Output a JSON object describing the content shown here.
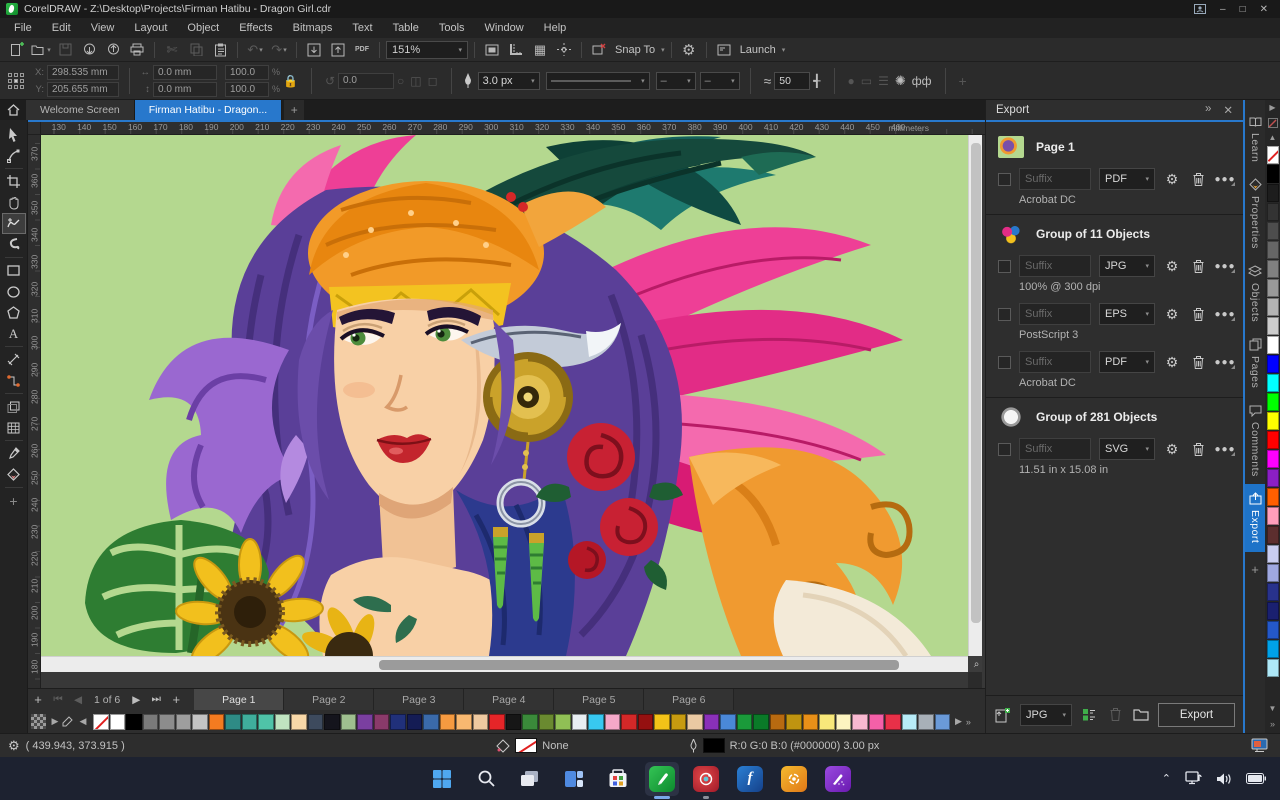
{
  "accent": {
    "active_blue": "#2878cc",
    "corel_green": "#1fa83a",
    "page_green": "#b4d88f"
  },
  "titlebar": {
    "title": "CorelDRAW - Z:\\Desktop\\Projects\\Firman Hatibu - Dragon Girl.cdr"
  },
  "menubar": {
    "items": [
      {
        "label": "File"
      },
      {
        "label": "Edit"
      },
      {
        "label": "View"
      },
      {
        "label": "Layout"
      },
      {
        "label": "Object"
      },
      {
        "label": "Effects"
      },
      {
        "label": "Bitmaps"
      },
      {
        "label": "Text"
      },
      {
        "label": "Table"
      },
      {
        "label": "Tools"
      },
      {
        "label": "Window"
      },
      {
        "label": "Help"
      }
    ]
  },
  "toolbar": {
    "zoom_level": "151%",
    "pdf_label": "PDF",
    "snap_to_label": "Snap To",
    "launch_label": "Launch"
  },
  "property_bar": {
    "x_label": "X:",
    "x_value": "298.535 mm",
    "y_label": "Y:",
    "y_value": "205.655 mm",
    "width_value": "0.0 mm",
    "height_value": "0.0 mm",
    "scale_x": "100.0",
    "scale_y": "100.0",
    "percent": "%",
    "angle_value": "0.0",
    "outline_width": "3.0 px",
    "smoothing_value": "50"
  },
  "document_tabs": {
    "active_index": 1,
    "tabs": [
      {
        "label": "Welcome Screen"
      },
      {
        "label": "Firman Hatibu - Dragon..."
      }
    ]
  },
  "ruler": {
    "unit": "millimeters",
    "h_ticks": [
      130,
      140,
      150,
      160,
      170,
      180,
      190,
      200,
      210,
      220,
      230,
      240,
      250,
      260,
      270,
      280,
      290,
      300,
      310,
      320,
      330,
      340,
      350,
      360,
      370,
      380,
      390,
      400,
      410,
      420,
      430,
      440,
      450,
      460
    ],
    "v_ticks": [
      370,
      360,
      350,
      340,
      330,
      320,
      310,
      300,
      290,
      280,
      270,
      260,
      250,
      240,
      230,
      220,
      210,
      200,
      190,
      180
    ]
  },
  "toolbox": {
    "active_index": 4,
    "tools": [
      "pick",
      "shape",
      "crop",
      "pan",
      "freehand",
      "artistic-media",
      "rectangle",
      "ellipse",
      "polygon",
      "text",
      "parallel-dimension",
      "connector",
      "drop-shadow",
      "mesh-fill",
      "color-eyedropper",
      "interactive-fill",
      "add-tool"
    ]
  },
  "export_panel": {
    "title": "Export",
    "groups": [
      {
        "name": "Page 1",
        "items": [
          {
            "suffix_placeholder": "Suffix",
            "format": "PDF",
            "detail": "Acrobat DC"
          }
        ]
      },
      {
        "name": "Group of 11 Objects",
        "items": [
          {
            "suffix_placeholder": "Suffix",
            "format": "JPG",
            "detail": "100% @ 300 dpi"
          },
          {
            "suffix_placeholder": "Suffix",
            "format": "EPS",
            "detail": "PostScript 3"
          },
          {
            "suffix_placeholder": "Suffix",
            "format": "PDF",
            "detail": "Acrobat DC"
          }
        ]
      },
      {
        "name": "Group of 281 Objects",
        "items": [
          {
            "suffix_placeholder": "Suffix",
            "format": "SVG",
            "detail": "11.51 in x 15.08 in"
          }
        ]
      }
    ],
    "footer": {
      "format": "JPG",
      "export_button": "Export"
    }
  },
  "docker_tabs": {
    "active_index": 5,
    "items": [
      {
        "label": "Learn"
      },
      {
        "label": "Properties"
      },
      {
        "label": "Objects"
      },
      {
        "label": "Pages"
      },
      {
        "label": "Comments"
      },
      {
        "label": "Export"
      }
    ]
  },
  "page_bar": {
    "counter": "1 of 6",
    "active_index": 0,
    "pages": [
      {
        "label": "Page 1"
      },
      {
        "label": "Page 2"
      },
      {
        "label": "Page 3"
      },
      {
        "label": "Page 4"
      },
      {
        "label": "Page 5"
      },
      {
        "label": "Page 6"
      }
    ]
  },
  "status_bar": {
    "coordinates": "( 439.943, 373.915 )",
    "fill_value": "None",
    "outline_value": "R:0 G:0 B:0 (#000000)  3.00 px"
  },
  "palettes": {
    "bottom": [
      "none",
      "#ffffff",
      "#000000",
      "#7a7a7a",
      "#8c8c8c",
      "#9e9e9e",
      "#c4c4c4",
      "#f47b20",
      "#2e8b85",
      "#3fae9c",
      "#4fc3a8",
      "#bfe3c0",
      "#f8d8a8",
      "#3d4a5d",
      "#14141c",
      "#9fbf8f",
      "#7a3fa0",
      "#8a3a6a",
      "#20307a",
      "#141c54",
      "#3a6aaa",
      "#f59a40",
      "#f8b870",
      "#eec9a0",
      "#e52528",
      "#161616",
      "#3a8a3a",
      "#6a8a30",
      "#90bf55",
      "#e8eef2",
      "#38c8f0",
      "#f4a8c8",
      "#d42828",
      "#951010",
      "#f2c218",
      "#c79b10",
      "#eac9a2",
      "#8a30b8",
      "#4a88d8",
      "#1a9a3a",
      "#0a7a28",
      "#b86a10",
      "#bf9410",
      "#e89018",
      "#f8e87a",
      "#fdf4c0",
      "#f8b8d0",
      "#f460a8",
      "#e83048",
      "#b8ecf8",
      "#a8b0b8",
      "#6a9ad8"
    ],
    "right": [
      "none",
      "#000000",
      "#1d1d1d",
      "#333333",
      "#4d4d4d",
      "#666666",
      "#808080",
      "#999999",
      "#b3b3b3",
      "#cccccc",
      "#ffffff",
      "#0000ff",
      "#00ffff",
      "#00ff00",
      "#ffff00",
      "#ff0000",
      "#ff00ff",
      "#8b1fc4",
      "#ff5f00",
      "#ff9ebb",
      "#5c2e2e",
      "#c9cdf0",
      "#9fa8e0",
      "#28328c",
      "#1a2070",
      "#2458c8",
      "#00a2e8",
      "#aee8f8"
    ]
  },
  "taskbar": {
    "apps": [
      "start",
      "search",
      "task-view",
      "widgets",
      "microsoft-store",
      "coreldraw",
      "photo-paint",
      "font-manager",
      "corel-cloud",
      "corel-capture"
    ],
    "tray": [
      "tray-expand",
      "network",
      "volume",
      "battery"
    ]
  }
}
